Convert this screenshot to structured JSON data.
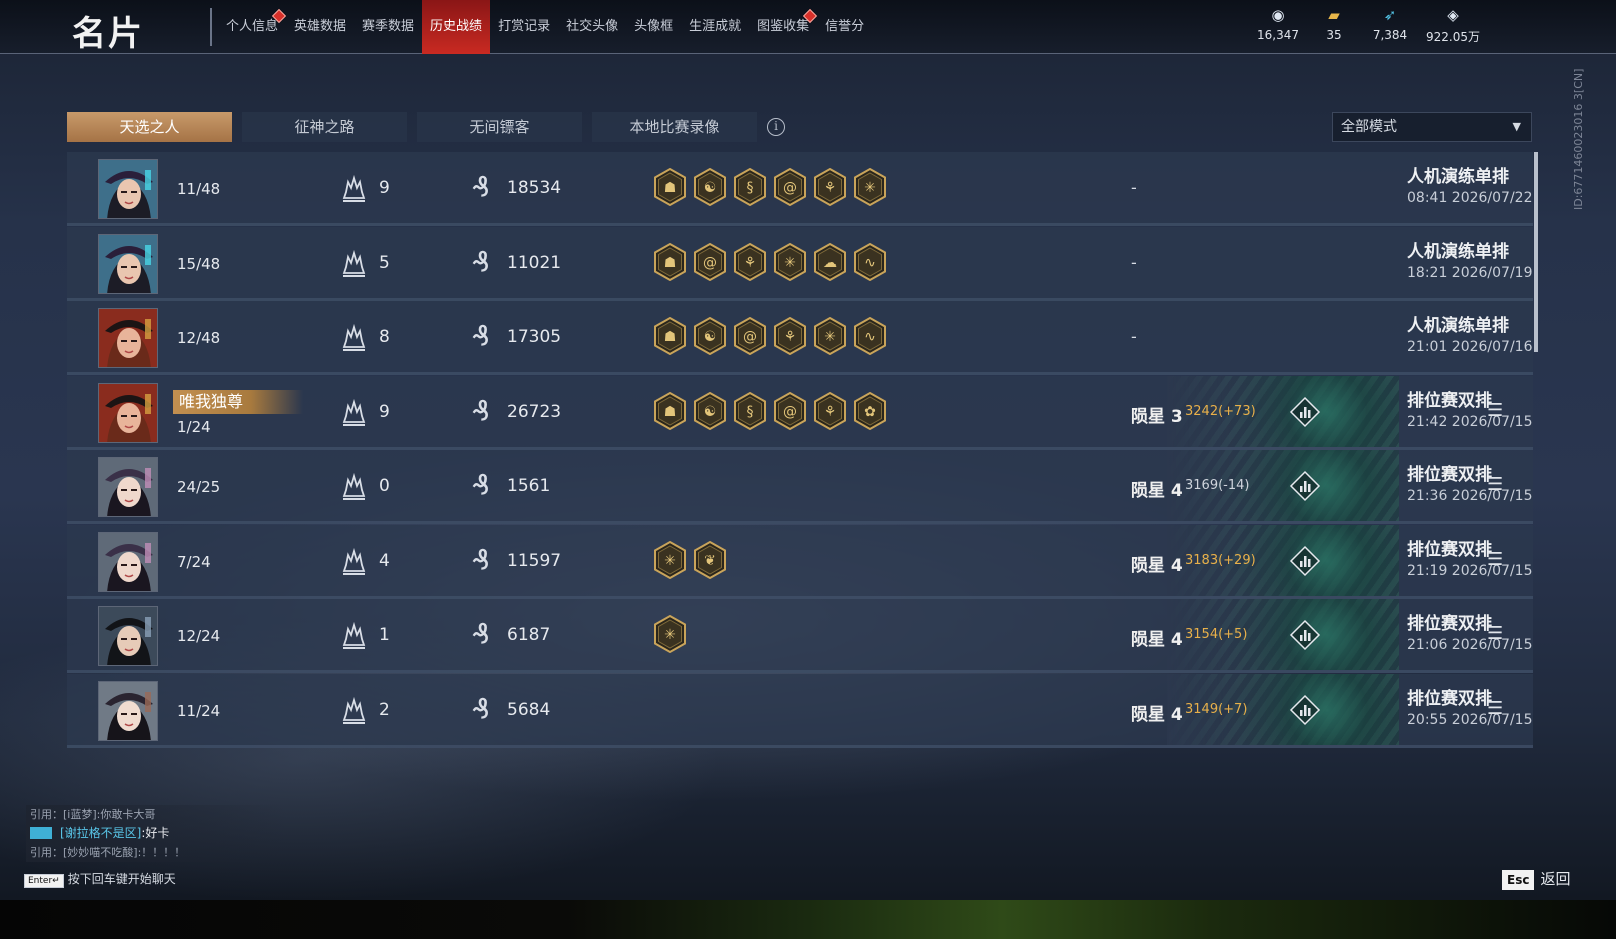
{
  "header": {
    "title": "名片",
    "nav": [
      {
        "label": "个人信息",
        "dot": true,
        "active": false
      },
      {
        "label": "英雄数据",
        "dot": false,
        "active": false
      },
      {
        "label": "赛季数据",
        "dot": false,
        "active": false
      },
      {
        "label": "历史战绩",
        "dot": false,
        "active": true
      },
      {
        "label": "打赏记录",
        "dot": false,
        "active": false
      },
      {
        "label": "社交头像",
        "dot": false,
        "active": false
      },
      {
        "label": "头像框",
        "dot": false,
        "active": false
      },
      {
        "label": "生涯成就",
        "dot": false,
        "active": false
      },
      {
        "label": "图鉴收集",
        "dot": true,
        "active": false
      },
      {
        "label": "信誉分",
        "dot": false,
        "active": false
      }
    ],
    "currencies": [
      {
        "icon": "eye-coin-icon",
        "value": "16,347"
      },
      {
        "icon": "gold-ingot-icon",
        "value": "35"
      },
      {
        "icon": "feather-icon",
        "value": "7,384"
      },
      {
        "icon": "diamond-icon",
        "value": "922.05万"
      }
    ]
  },
  "tabs": [
    "天选之人",
    "征神之路",
    "无间镖客",
    "本地比赛录像"
  ],
  "active_tab": 0,
  "mode_filter": "全部模式",
  "records": [
    {
      "place": "11/48",
      "kills": "9",
      "score": "18534",
      "badges": [
        "demon",
        "swirl",
        "dragon",
        "spiral",
        "split",
        "star"
      ],
      "rank": null,
      "rank_pts": null,
      "rank_up": false,
      "mode": "人机演练单排",
      "time": "08:41 2026/07/22",
      "title_badge": null,
      "avatar": "witch"
    },
    {
      "place": "15/48",
      "kills": "5",
      "score": "11021",
      "badges": [
        "demon",
        "spiral",
        "split",
        "star",
        "cloud",
        "wave"
      ],
      "rank": null,
      "rank_pts": null,
      "rank_up": false,
      "mode": "人机演练单排",
      "time": "18:21 2026/07/19",
      "title_badge": null,
      "avatar": "witch"
    },
    {
      "place": "12/48",
      "kills": "8",
      "score": "17305",
      "badges": [
        "demon",
        "swirl",
        "spiral",
        "split",
        "star",
        "wave"
      ],
      "rank": null,
      "rank_pts": null,
      "rank_up": false,
      "mode": "人机演练单排",
      "time": "21:01 2026/07/16",
      "title_badge": null,
      "avatar": "hat"
    },
    {
      "place": "1/24",
      "kills": "9",
      "score": "26723",
      "badges": [
        "demon",
        "swirl",
        "dragon",
        "spiral",
        "split",
        "lotus"
      ],
      "rank": "陨星 3",
      "rank_pts": "3242(+73)",
      "rank_up": true,
      "mode": "排位赛双排",
      "time": "21:42 2026/07/15",
      "title_badge": "唯我独尊",
      "avatar": "hat"
    },
    {
      "place": "24/25",
      "kills": "0",
      "score": "1561",
      "badges": [],
      "rank": "陨星 4",
      "rank_pts": "3169(-14)",
      "rank_up": false,
      "mode": "排位赛双排",
      "time": "21:36 2026/07/15",
      "title_badge": null,
      "avatar": "lady"
    },
    {
      "place": "7/24",
      "kills": "4",
      "score": "11597",
      "badges": [
        "star",
        "wing"
      ],
      "rank": "陨星 4",
      "rank_pts": "3183(+29)",
      "rank_up": true,
      "mode": "排位赛双排",
      "time": "21:19 2026/07/15",
      "title_badge": null,
      "avatar": "lady"
    },
    {
      "place": "12/24",
      "kills": "1",
      "score": "6187",
      "badges": [
        "star"
      ],
      "rank": "陨星 4",
      "rank_pts": "3154(+5)",
      "rank_up": true,
      "mode": "排位赛双排",
      "time": "21:06 2026/07/15",
      "title_badge": null,
      "avatar": "swordsman"
    },
    {
      "place": "11/24",
      "kills": "2",
      "score": "5684",
      "badges": [],
      "rank": "陨星 4",
      "rank_pts": "3149(+7)",
      "rank_up": true,
      "mode": "排位赛双排",
      "time": "20:55 2026/07/15",
      "title_badge": null,
      "avatar": "maiden"
    }
  ],
  "no_rank_text": "-",
  "side_id": "ID:6771460023016 3[CN]",
  "chat": {
    "quote1": "引用：[i蓝梦]:你敢卡大哥",
    "main_name": "[谢拉格不是区]",
    "main_text": ":好卡",
    "quote2": "引用：[妙妙喵不吃酸]:！！！！",
    "enter_key": "Enter↵",
    "hint": "按下回车键开始聊天"
  },
  "footer": {
    "esc_key": "Esc",
    "back_label": "返回"
  }
}
